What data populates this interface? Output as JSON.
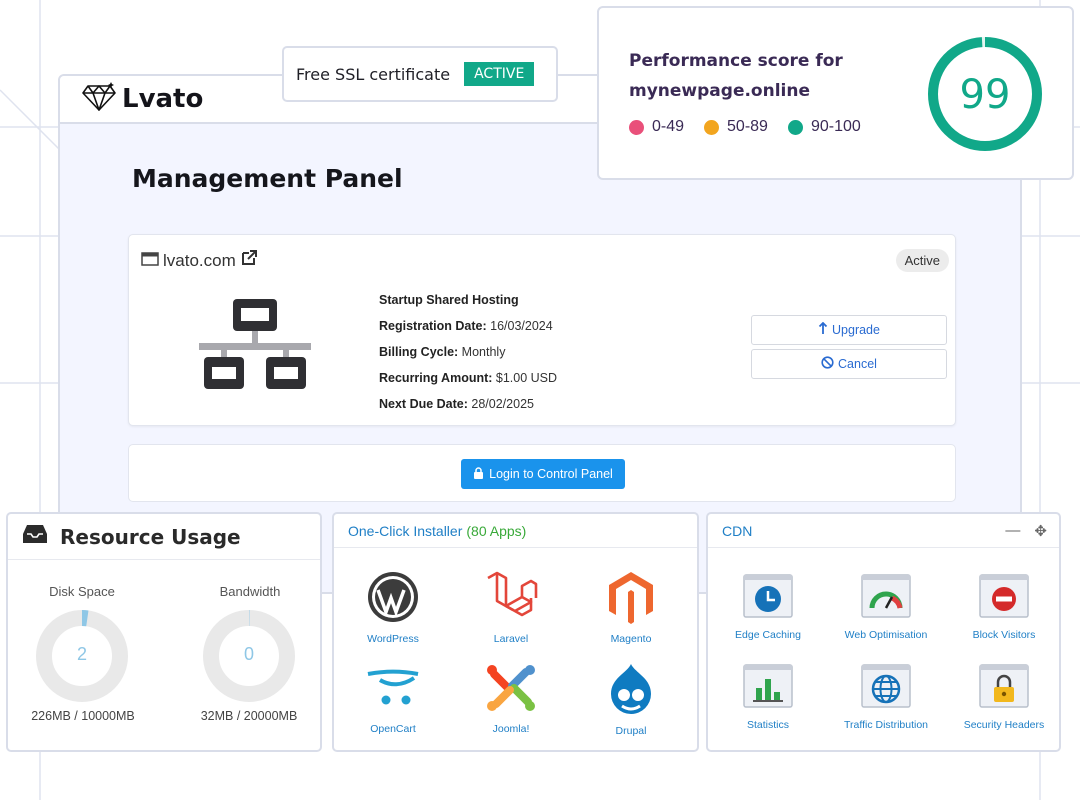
{
  "brand": {
    "name": "Lvato"
  },
  "page": {
    "title": "Management Panel"
  },
  "service": {
    "domain": "lvato.com",
    "status": "Active",
    "plan": "Startup Shared Hosting",
    "registration_label": "Registration Date:",
    "registration_value": "16/03/2024",
    "billing_label": "Billing Cycle:",
    "billing_value": "Monthly",
    "amount_label": "Recurring Amount:",
    "amount_value": "$1.00 USD",
    "due_label": "Next Due Date:",
    "due_value": "28/02/2025",
    "upgrade_label": "Upgrade",
    "cancel_label": "Cancel",
    "login_label": "Login to Control Panel"
  },
  "ssl": {
    "text": "Free SSL certificate",
    "badge": "ACTIVE",
    "badge_color": "#11a889"
  },
  "performance": {
    "title_line1": "Performance score for",
    "title_line2": "mynewpage.online",
    "score": "99",
    "score_color": "#11a889",
    "legend": [
      {
        "label": "0-49",
        "color": "#e9507a"
      },
      {
        "label": "50-89",
        "color": "#f2a51f"
      },
      {
        "label": "90-100",
        "color": "#11a889"
      }
    ]
  },
  "resources": {
    "title": "Resource Usage",
    "disk": {
      "label": "Disk Space",
      "value": "2",
      "caption": "226MB / 10000MB",
      "fraction": 0.0226
    },
    "bandwidth": {
      "label": "Bandwidth",
      "value": "0",
      "caption": "32MB / 20000MB",
      "fraction": 0.0016
    }
  },
  "installer": {
    "title": "One-Click Installer",
    "count": "(80 Apps)",
    "apps": [
      {
        "name": "WordPress",
        "icon": "wordpress-icon"
      },
      {
        "name": "Laravel",
        "icon": "laravel-icon"
      },
      {
        "name": "Magento",
        "icon": "magento-icon"
      },
      {
        "name": "OpenCart",
        "icon": "opencart-icon"
      },
      {
        "name": "Joomla!",
        "icon": "joomla-icon"
      },
      {
        "name": "Drupal",
        "icon": "drupal-icon"
      }
    ]
  },
  "cdn": {
    "title": "CDN",
    "items": [
      {
        "name": "Edge Caching",
        "icon": "clock-icon"
      },
      {
        "name": "Web Optimisation",
        "icon": "speedometer-icon"
      },
      {
        "name": "Block Visitors",
        "icon": "block-icon"
      },
      {
        "name": "Statistics",
        "icon": "bar-chart-icon"
      },
      {
        "name": "Traffic Distribution",
        "icon": "globe-icon"
      },
      {
        "name": "Security Headers",
        "icon": "lock-icon"
      }
    ]
  }
}
